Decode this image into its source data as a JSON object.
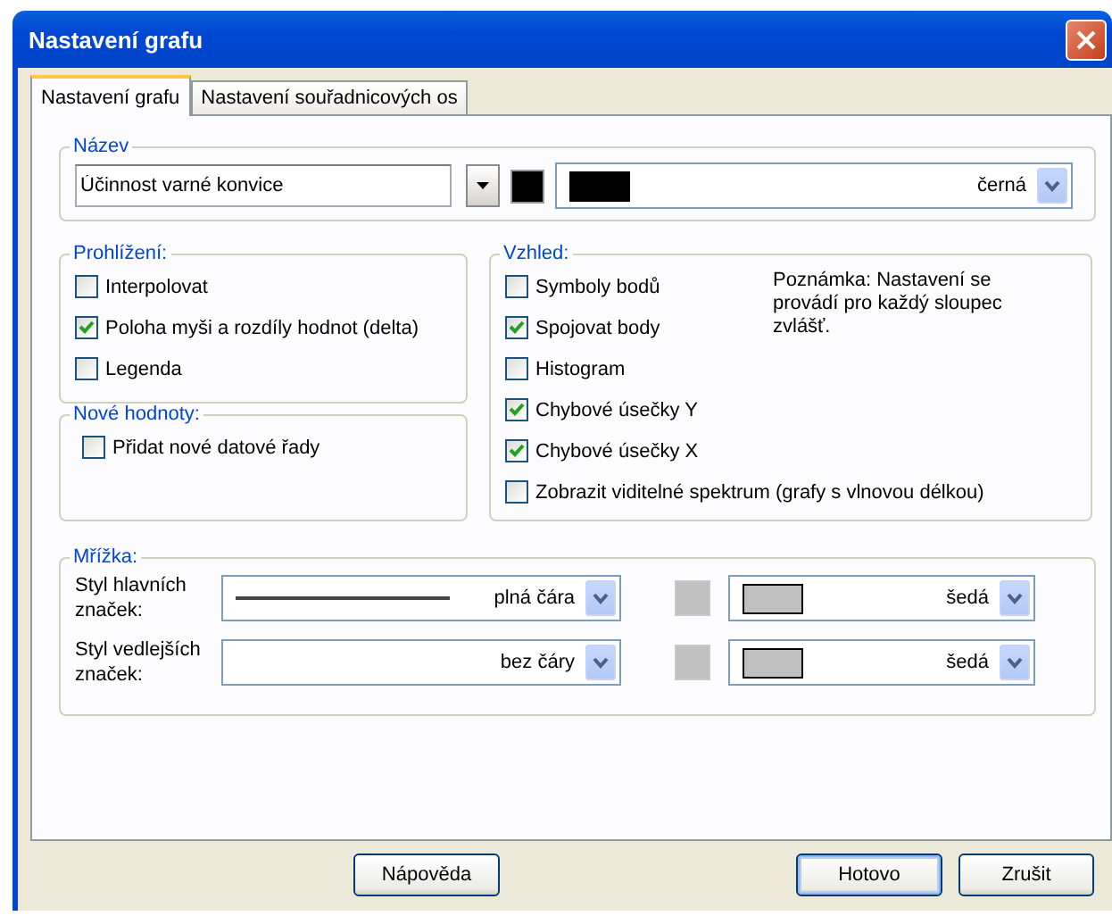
{
  "window": {
    "title": "Nastavení grafu"
  },
  "tabs": [
    {
      "label": "Nastavení grafu",
      "selected": true
    },
    {
      "label": "Nastavení souřadnicových os",
      "selected": false
    }
  ],
  "title_group": {
    "legend": "Název",
    "value": "Účinnost varné konvice",
    "color_label": "černá",
    "color": "#000000"
  },
  "view_group": {
    "legend": "Prohlížení:",
    "options": [
      {
        "label": "Interpolovat",
        "checked": false
      },
      {
        "label": "Poloha myši a rozdíly hodnot (delta)",
        "checked": true
      },
      {
        "label": "Legenda",
        "checked": false
      }
    ]
  },
  "new_values_group": {
    "legend": "Nové hodnoty:",
    "options": [
      {
        "label": "Přidat nové datové řady",
        "checked": false
      }
    ]
  },
  "appearance_group": {
    "legend": "Vzhled:",
    "note": "Poznámka: Nastavení se provádí pro každý sloupec zvlášť.",
    "options": [
      {
        "label": "Symboly bodů",
        "checked": false
      },
      {
        "label": "Spojovat body",
        "checked": true
      },
      {
        "label": "Histogram",
        "checked": false
      },
      {
        "label": "Chybové úsečky Y",
        "checked": true
      },
      {
        "label": "Chybové úsečky X",
        "checked": true
      },
      {
        "label": "Zobrazit viditelné spektrum (grafy s vlnovou délkou)",
        "checked": false
      }
    ]
  },
  "grid_group": {
    "legend": "Mřížka:",
    "rows": [
      {
        "label": "Styl hlavních značek:",
        "kind": "solid",
        "line_label": "plná čára",
        "color_label": "šedá",
        "color": "#c0c0c0"
      },
      {
        "label": "Styl vedlejších značek:",
        "kind": "none",
        "line_label": "bez čáry",
        "color_label": "šedá",
        "color": "#c0c0c0"
      }
    ]
  },
  "buttons": [
    {
      "label": "Nápověda",
      "default": false
    },
    {
      "label": "Hotovo",
      "default": true
    },
    {
      "label": "Zrušit",
      "default": false
    }
  ]
}
